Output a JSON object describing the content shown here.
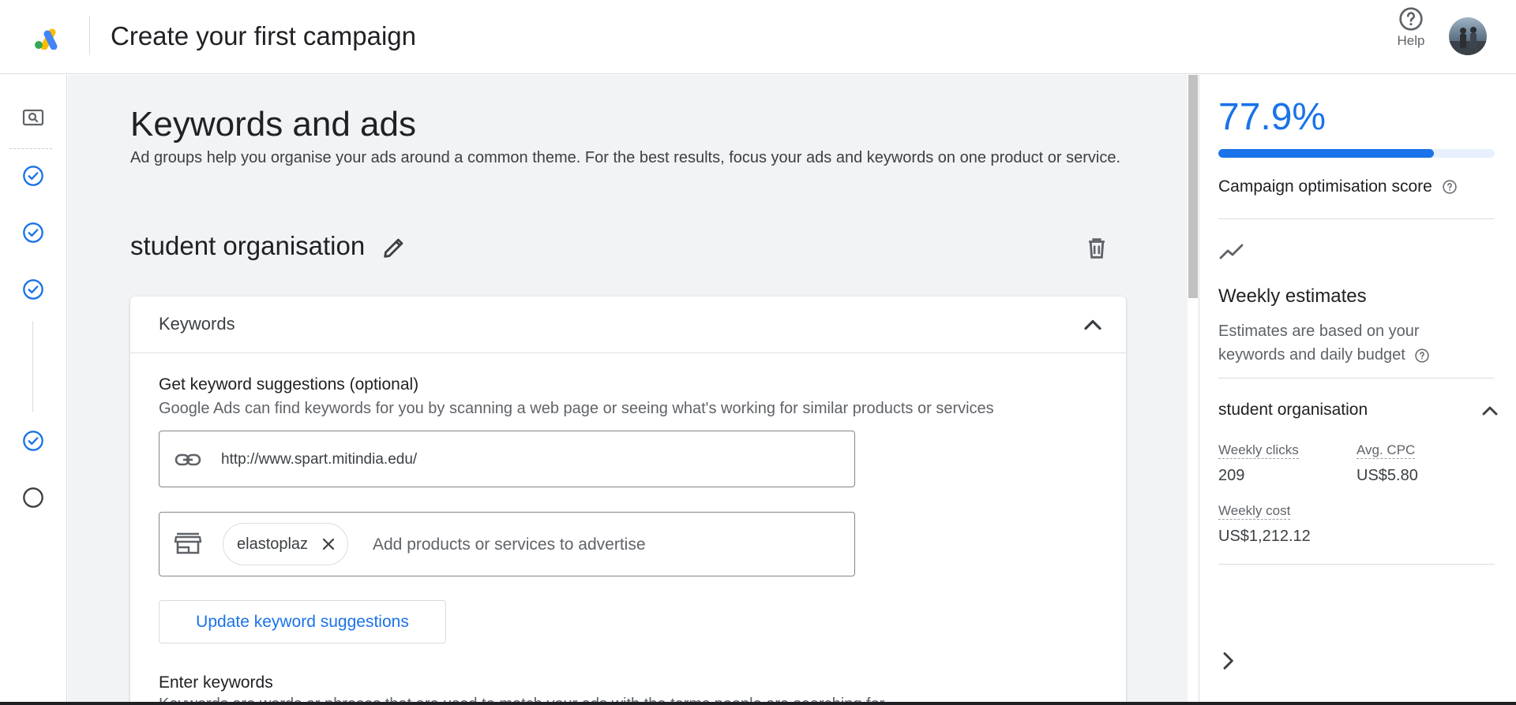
{
  "header": {
    "title": "Create your first campaign",
    "help_label": "Help"
  },
  "main": {
    "page_title": "Keywords and ads",
    "page_description": "Ad groups help you organise your ads around a common theme. For the best results, focus your ads and keywords on one product or service.",
    "ad_group_name": "student organisation",
    "keywords_card": {
      "title": "Keywords",
      "suggestions_title": "Get keyword suggestions (optional)",
      "suggestions_description": "Google Ads can find keywords for you by scanning a web page or seeing what's working for similar products or services",
      "url_value": "http://www.spart.mitindia.edu/",
      "product_chip": "elastoplaz",
      "product_placeholder": "Add products or services to advertise",
      "update_button": "Update keyword suggestions",
      "enter_keywords_title": "Enter keywords",
      "enter_keywords_description": "Keywords are words or phrases that are used to match your ads with the terms people are searching for"
    }
  },
  "right_panel": {
    "score_value": "77.9%",
    "score_fraction": 0.779,
    "score_label": "Campaign optimisation score",
    "weekly_title": "Weekly estimates",
    "weekly_description": "Estimates are based on your keywords and daily budget",
    "group_name": "student organisation",
    "metrics": {
      "weekly_clicks_label": "Weekly clicks",
      "weekly_clicks_value": "209",
      "avg_cpc_label": "Avg. CPC",
      "avg_cpc_value": "US$5.80",
      "weekly_cost_label": "Weekly cost",
      "weekly_cost_value": "US$1,212.12"
    }
  },
  "left_rail": {
    "steps": [
      "search-icon",
      "check-circle-icon",
      "check-circle-icon",
      "check-circle-icon",
      "check-circle-icon",
      "empty-circle-icon"
    ]
  },
  "colors": {
    "accent": "#1a73e8",
    "background": "#f1f3f4",
    "text": "#202124"
  }
}
